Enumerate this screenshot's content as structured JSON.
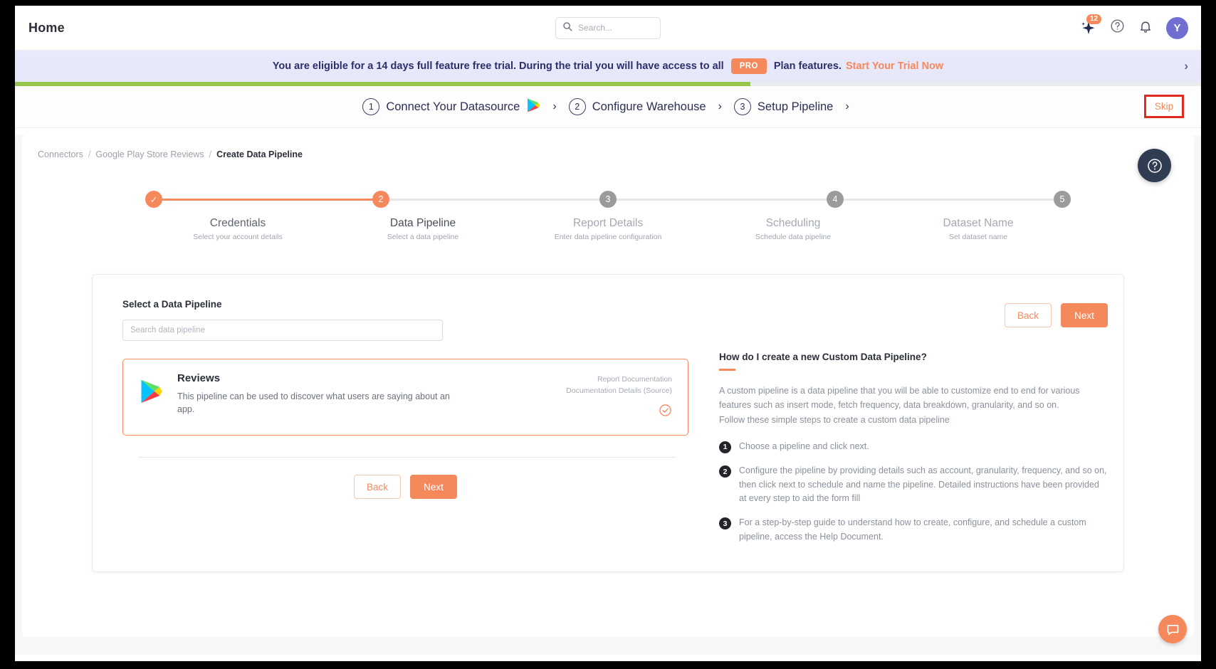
{
  "header": {
    "title": "Home",
    "search_placeholder": "Search...",
    "search_value": "",
    "ai_badge_count": "12",
    "avatar_initial": "Y",
    "icons": [
      "sparkle-icon",
      "help-circle-icon",
      "bell-icon"
    ]
  },
  "banner": {
    "text_before": "You are eligible for a 14 days full feature free trial. During the trial you will have access to all",
    "pill": "PRO",
    "text_after": "Plan features.",
    "cta": "Start Your Trial Now",
    "chevron": "›",
    "progress_percent": 62,
    "progress_color": "#95c64a"
  },
  "wizard": {
    "steps": [
      {
        "number": "1",
        "label": "Connect Your Datasource",
        "has_app_icon": true
      },
      {
        "number": "2",
        "label": "Configure Warehouse",
        "has_app_icon": false
      },
      {
        "number": "3",
        "label": "Setup Pipeline",
        "has_app_icon": false
      }
    ],
    "separator": "›",
    "skip_label": "Skip"
  },
  "breadcrumb": {
    "items": [
      "Connectors",
      "Google Play Store Reviews",
      "Create Data Pipeline"
    ],
    "separator": "/"
  },
  "stepper": {
    "current": 2,
    "accent": "#f5895b",
    "inactive": "#9b9b9b",
    "steps": [
      {
        "badge": "✓",
        "title": "Credentials",
        "subtitle": "Select your account details",
        "state": "done"
      },
      {
        "badge": "2",
        "title": "Data Pipeline",
        "subtitle": "Select a data pipeline",
        "state": "active"
      },
      {
        "badge": "3",
        "title": "Report Details",
        "subtitle": "Enter data pipeline configuration",
        "state": "todo"
      },
      {
        "badge": "4",
        "title": "Scheduling",
        "subtitle": "Schedule data pipeline",
        "state": "todo"
      },
      {
        "badge": "5",
        "title": "Dataset Name",
        "subtitle": "Set dataset name",
        "state": "todo"
      }
    ]
  },
  "panel": {
    "section_title": "Select a Data Pipeline",
    "search_placeholder": "Search data pipeline",
    "search_value": "",
    "pipeline": {
      "name": "Reviews",
      "description": "This pipeline can be used to discover what users are saying about an app.",
      "link_report_doc": "Report Documentation",
      "link_doc_details": "Documentation Details (Source)",
      "selected": true
    },
    "back_label": "Back",
    "next_label": "Next"
  },
  "help": {
    "heading": "How do I create a new Custom Data Pipeline?",
    "paragraph1": "A custom pipeline is a data pipeline that you will be able to customize end to end for various features such as insert mode, fetch frequency, data breakdown, granularity, and so on.",
    "paragraph2": "Follow these simple steps to create a custom data pipeline",
    "steps": [
      {
        "n": "1",
        "text": "Choose a pipeline and click next."
      },
      {
        "n": "2",
        "text": "Configure the pipeline by providing details such as account, granularity, frequency, and so on, then click next to schedule and name the pipeline. Detailed instructions have been provided at every step to aid the form fill"
      },
      {
        "n": "3",
        "text": "For a step-by-step guide to understand how to create, configure, and schedule a custom pipeline, access the Help Document."
      }
    ]
  },
  "floating": {
    "help_fab": "help-circle-icon",
    "chat_fab": "chat-bubble-icon"
  }
}
